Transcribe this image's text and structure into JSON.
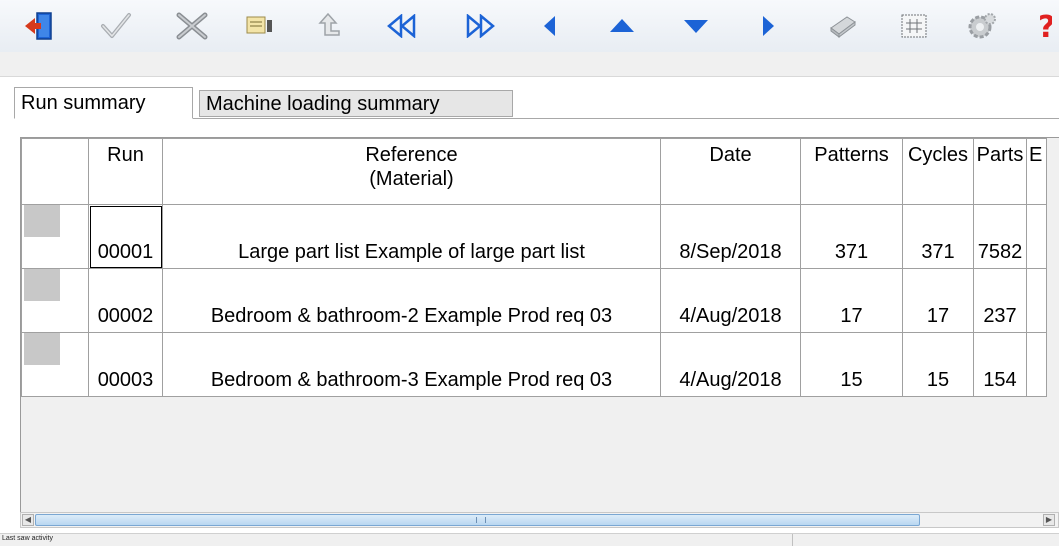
{
  "toolbar": {
    "buttons": [
      {
        "icon": "exit-door-icon"
      },
      {
        "icon": "check-icon"
      },
      {
        "icon": "cancel-x-icon"
      },
      {
        "icon": "edit-list-icon"
      },
      {
        "icon": "up-level-icon"
      },
      {
        "icon": "first-record-icon"
      },
      {
        "icon": "last-record-icon"
      },
      {
        "icon": "previous-icon"
      },
      {
        "icon": "up-arrow-icon"
      },
      {
        "icon": "down-arrow-icon"
      },
      {
        "icon": "next-icon"
      },
      {
        "icon": "print-icon"
      },
      {
        "icon": "grid-icon"
      },
      {
        "icon": "settings-gear-icon"
      },
      {
        "icon": "help-icon"
      }
    ]
  },
  "tabs": [
    {
      "label": "Run summary",
      "active": true
    },
    {
      "label": "Machine loading summary",
      "active": false
    }
  ],
  "table": {
    "headers": {
      "run": "Run",
      "reference": "Reference",
      "material": "(Material)",
      "date": "Date",
      "patterns": "Patterns",
      "cycles": "Cycles",
      "parts": "Parts",
      "extra": "E"
    },
    "rows": [
      {
        "run": "00001",
        "reference": "Large part list Example of large part list",
        "date": "8/Sep/2018",
        "patterns": "371",
        "cycles": "371",
        "parts": "7582"
      },
      {
        "run": "00002",
        "reference": "Bedroom & bathroom-2 Example Prod req 03",
        "date": "4/Aug/2018",
        "patterns": "17",
        "cycles": "17",
        "parts": "237"
      },
      {
        "run": "00003",
        "reference": "Bedroom & bathroom-3 Example Prod req 03",
        "date": "4/Aug/2018",
        "patterns": "15",
        "cycles": "15",
        "parts": "154"
      }
    ]
  },
  "status": {
    "text": "Last saw activity"
  },
  "colors": {
    "accent_blue": "#1c63d6",
    "help_red": "#e02020",
    "exit_red": "#d63a1c"
  }
}
